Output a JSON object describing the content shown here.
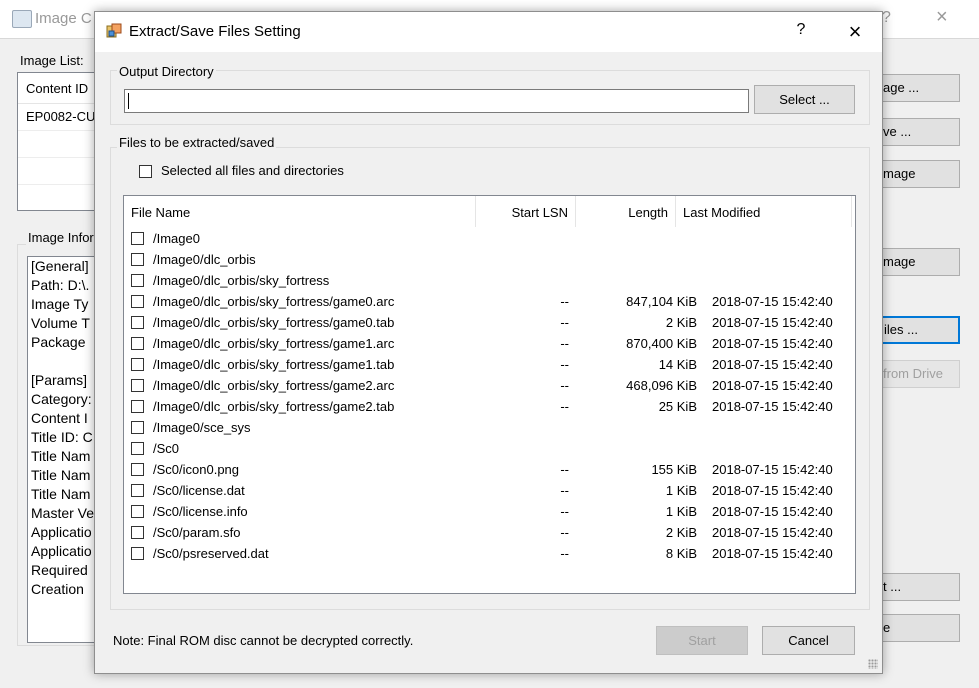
{
  "background_window": {
    "title": "Image C",
    "help_glyph": "?",
    "close_glyph": "×",
    "image_list_label": "Image List:",
    "list_header": "Content ID",
    "list_first_value": "EP0082-CU",
    "image_info_label": "Image Infor",
    "info_lines": [
      "[General]",
      "Path: D:\\.",
      "Image Ty",
      "Volume T",
      "Package",
      "",
      "[Params]",
      "Category:",
      "Content I",
      "Title ID: C",
      "Title Nam",
      "Title Nam",
      "Title Nam",
      "Master Ve",
      "Applicatio",
      "Applicatio",
      "Required",
      "Creation"
    ],
    "buttons": [
      "age ...",
      "ve ...",
      "mage",
      "mage",
      "iles ...",
      "from Drive",
      "t ...",
      "e"
    ]
  },
  "dialog": {
    "title": "Extract/Save Files Setting",
    "help_glyph": "?",
    "close_glyph": "×",
    "output_group_title": "Output Directory",
    "output_value": "",
    "select_button": "Select ...",
    "files_group_title": "Files to be extracted/saved",
    "select_all_label": "Selected all files and directories",
    "columns": {
      "name": "File Name",
      "lsn": "Start LSN",
      "length": "Length",
      "modified": "Last Modified"
    },
    "files": [
      {
        "name": "/Image0",
        "lsn": "",
        "length": "",
        "modified": ""
      },
      {
        "name": "/Image0/dlc_orbis",
        "lsn": "",
        "length": "",
        "modified": ""
      },
      {
        "name": "/Image0/dlc_orbis/sky_fortress",
        "lsn": "",
        "length": "",
        "modified": ""
      },
      {
        "name": "/Image0/dlc_orbis/sky_fortress/game0.arc",
        "lsn": "--",
        "length": "847,104 KiB",
        "modified": "2018-07-15 15:42:40"
      },
      {
        "name": "/Image0/dlc_orbis/sky_fortress/game0.tab",
        "lsn": "--",
        "length": "2 KiB",
        "modified": "2018-07-15 15:42:40"
      },
      {
        "name": "/Image0/dlc_orbis/sky_fortress/game1.arc",
        "lsn": "--",
        "length": "870,400 KiB",
        "modified": "2018-07-15 15:42:40"
      },
      {
        "name": "/Image0/dlc_orbis/sky_fortress/game1.tab",
        "lsn": "--",
        "length": "14 KiB",
        "modified": "2018-07-15 15:42:40"
      },
      {
        "name": "/Image0/dlc_orbis/sky_fortress/game2.arc",
        "lsn": "--",
        "length": "468,096 KiB",
        "modified": "2018-07-15 15:42:40"
      },
      {
        "name": "/Image0/dlc_orbis/sky_fortress/game2.tab",
        "lsn": "--",
        "length": "25 KiB",
        "modified": "2018-07-15 15:42:40"
      },
      {
        "name": "/Image0/sce_sys",
        "lsn": "",
        "length": "",
        "modified": ""
      },
      {
        "name": "/Sc0",
        "lsn": "",
        "length": "",
        "modified": ""
      },
      {
        "name": "/Sc0/icon0.png",
        "lsn": "--",
        "length": "155 KiB",
        "modified": "2018-07-15 15:42:40"
      },
      {
        "name": "/Sc0/license.dat",
        "lsn": "--",
        "length": "1 KiB",
        "modified": "2018-07-15 15:42:40"
      },
      {
        "name": "/Sc0/license.info",
        "lsn": "--",
        "length": "1 KiB",
        "modified": "2018-07-15 15:42:40"
      },
      {
        "name": "/Sc0/param.sfo",
        "lsn": "--",
        "length": "2 KiB",
        "modified": "2018-07-15 15:42:40"
      },
      {
        "name": "/Sc0/psreserved.dat",
        "lsn": "--",
        "length": "8 KiB",
        "modified": "2018-07-15 15:42:40"
      }
    ],
    "note": "Note: Final ROM disc cannot be decrypted correctly.",
    "start_button": "Start",
    "cancel_button": "Cancel"
  },
  "colors": {
    "accent_focus": "#0078d7",
    "window_bg": "#f0f0f0"
  }
}
